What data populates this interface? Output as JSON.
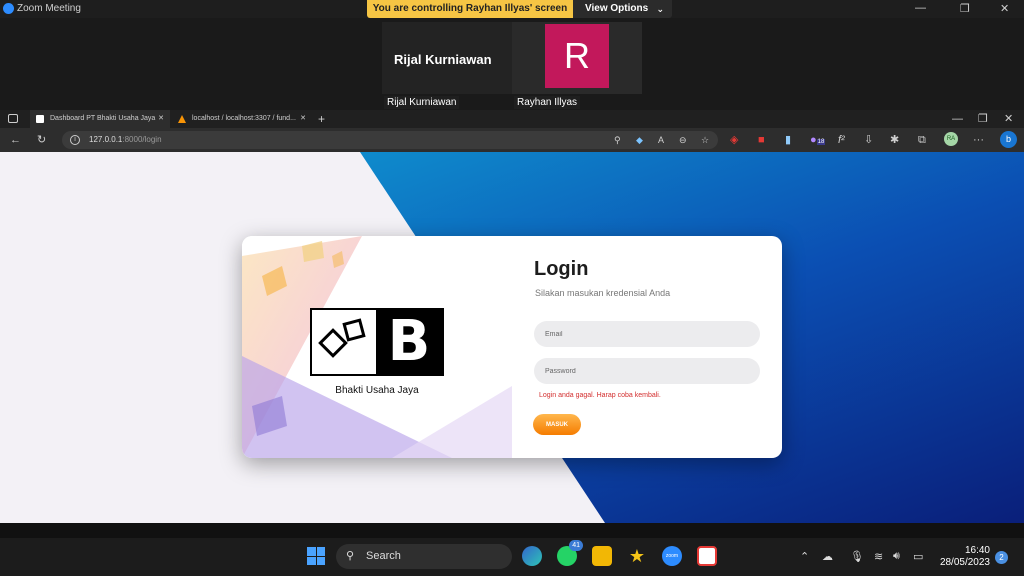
{
  "zoom": {
    "app_title": "Zoom Meeting",
    "banner": "You are controlling Rayhan Illyas' screen",
    "view_options": "View Options",
    "tiles": [
      {
        "display": "Rijal Kurniawan",
        "label": "Rijal Kurniawan"
      },
      {
        "initial": "R",
        "label": "Rayhan Illyas",
        "color": "#c2185b"
      }
    ]
  },
  "browser": {
    "tabs": [
      {
        "label": "Dashboard PT Bhakti Usaha Jaya"
      },
      {
        "label": "localhost / localhost:3307 / fund..."
      }
    ],
    "url_host": "127.0.0.1",
    "url_rest": ":8000/login",
    "profile_initials": "RA",
    "extension_badge": "18"
  },
  "page": {
    "brand_caption": "Bhakti Usaha Jaya",
    "logo_letter": "B",
    "title": "Login",
    "subtitle": "Silakan masukan kredensial Anda",
    "email_placeholder": "Email",
    "password_placeholder": "Password",
    "error": "Login anda gagal. Harap coba kembali.",
    "submit": "MASUK",
    "accent": "#f57c00",
    "error_color": "#d32f2f"
  },
  "taskbar": {
    "search": "Search",
    "whatsapp_badge": "41",
    "time": "16:40",
    "date": "28/05/2023",
    "notifications": "2"
  }
}
